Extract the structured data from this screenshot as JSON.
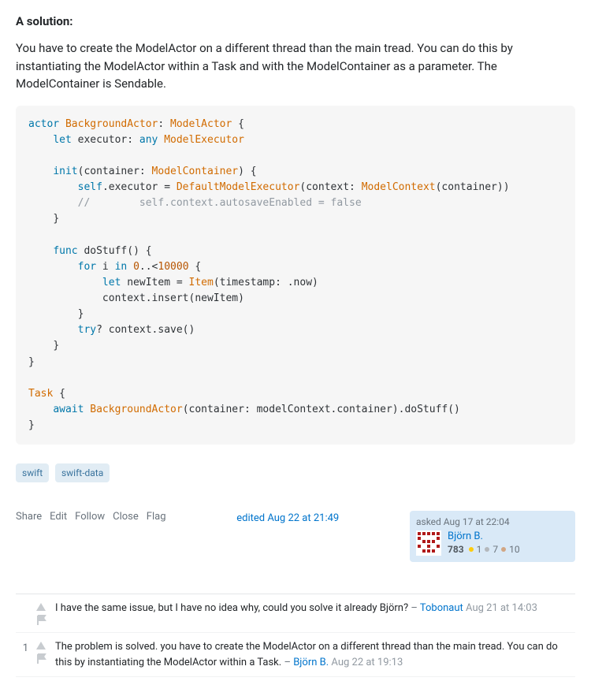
{
  "heading": "A solution:",
  "body_text": "You have to create the ModelActor on a different thread than the main tread. You can do this by instantiating the ModelActor within a Task and with the ModelContainer as a parameter. The ModelContainer is Sendable.",
  "code": {
    "l1_kw1": "actor",
    "l1_type1": "BackgroundActor",
    "l1_sep": ": ",
    "l1_type2": "ModelActor",
    "l1_end": " {",
    "l2_kw": "let",
    "l2_txt": " executor: ",
    "l2_kw2": "any",
    "l2_type": " ModelExecutor",
    "l3_kw": "init",
    "l3_txt": "(container: ",
    "l3_type": "ModelContainer",
    "l3_end": ") {",
    "l4_kw": "self",
    "l4_txt": ".executor = ",
    "l4_type1": "DefaultModelExecutor",
    "l4_txt2": "(context: ",
    "l4_type2": "ModelContext",
    "l4_txt3": "(container))",
    "l5_comment": "//        self.context.autosaveEnabled = false",
    "l6": "}",
    "l7_kw": "func",
    "l7_fn": " doStuff",
    "l7_end": "() {",
    "l8_kw": "for",
    "l8_txt": " i ",
    "l8_kw2": "in",
    "l8_num": " 0",
    "l8_txt2": "..<",
    "l8_num2": "10000",
    "l8_end": " {",
    "l9_kw": "let",
    "l9_txt": " newItem = ",
    "l9_type": "Item",
    "l9_txt2": "(timestamp: .now)",
    "l10": "context.insert(newItem)",
    "l11": "}",
    "l12_kw": "try",
    "l12_txt": "? context.save()",
    "l13": "}",
    "l14": "}",
    "l15_type": "Task",
    "l15_end": " {",
    "l16_kw": "await",
    "l16_type": " BackgroundActor",
    "l16_txt": "(container: modelContext.container).doStuff()",
    "l17": "}"
  },
  "tags": [
    "swift",
    "swift-data"
  ],
  "action_links": [
    "Share",
    "Edit",
    "Follow",
    "Close",
    "Flag"
  ],
  "edited": "edited Aug 22 at 21:49",
  "asked_label": "asked Aug 17 at 22:04",
  "user": {
    "name": "Björn B.",
    "rep": "783",
    "gold": "1",
    "silver": "7",
    "bronze": "10"
  },
  "comments": [
    {
      "score": "",
      "text": "I have the same issue, but I have no idea why, could you solve it already Björn?",
      "user": "Tobonaut",
      "date": "Aug 21 at 14:03"
    },
    {
      "score": "1",
      "text": "The problem is solved. you have to create the ModelActor on a different thread than the main tread. You can do this by instantiating the ModelActor within a Task.",
      "user": "Björn B.",
      "date": "Aug 22 at 19:13"
    }
  ],
  "sep": " – "
}
